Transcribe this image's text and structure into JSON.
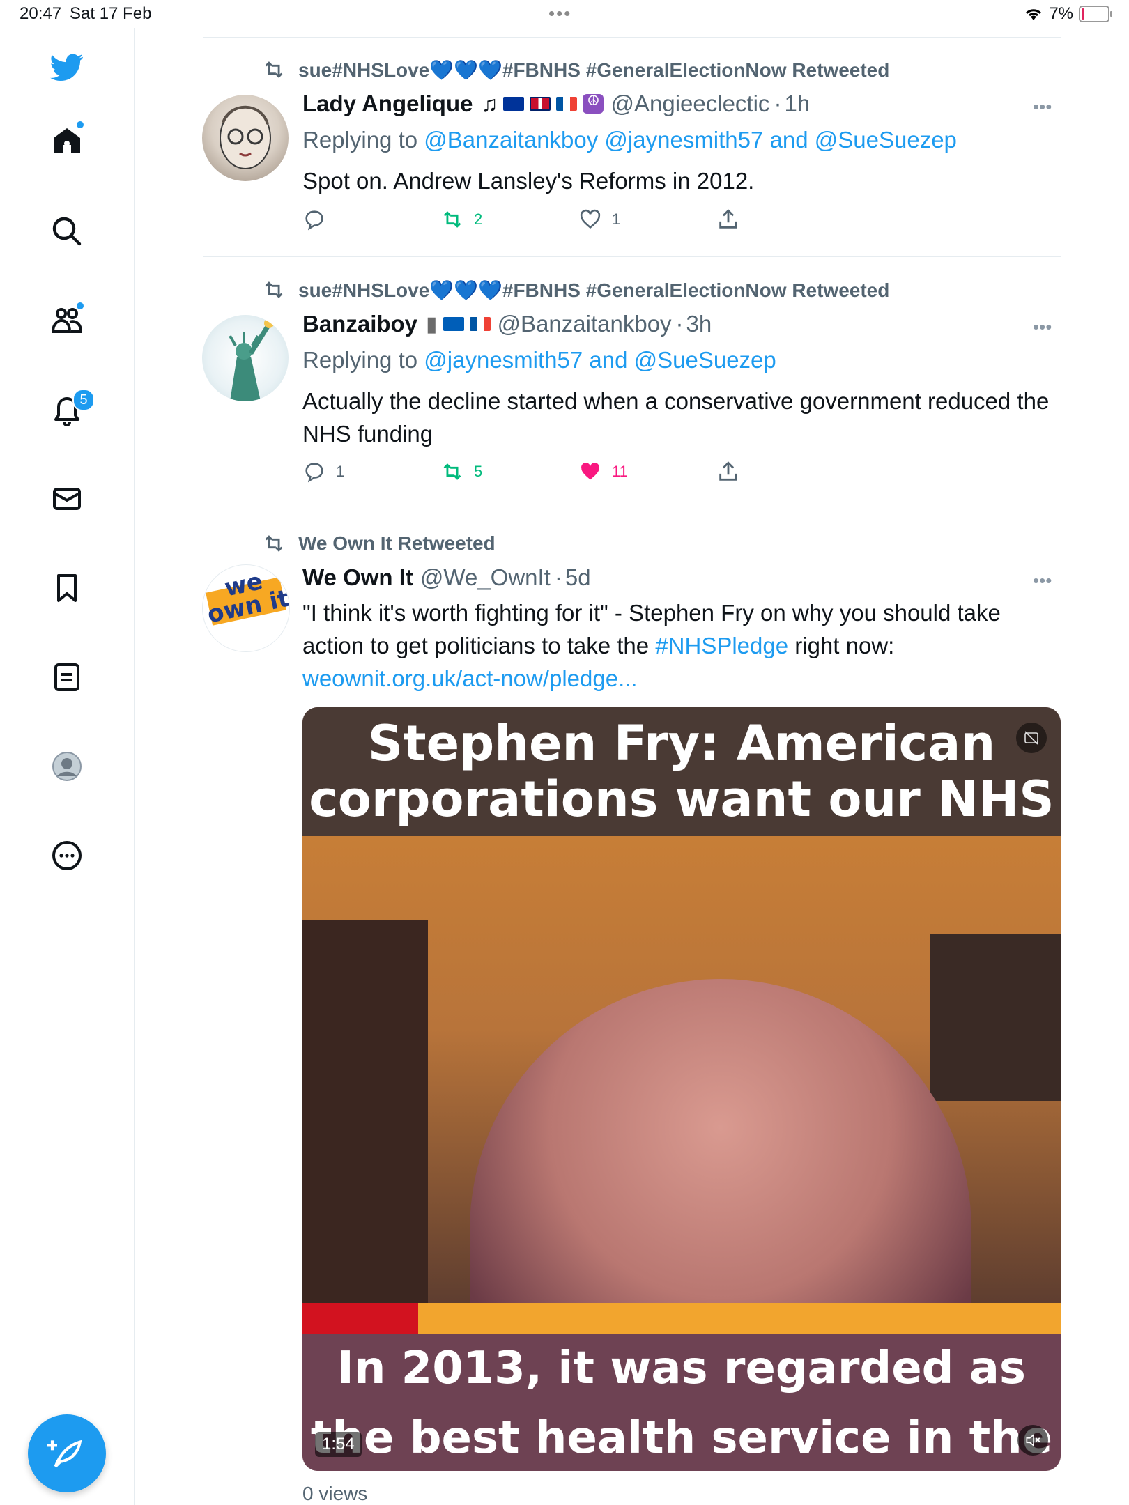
{
  "status_bar": {
    "time": "20:47",
    "date": "Sat 17 Feb",
    "battery": "7%"
  },
  "sidebar": {
    "notification_count": "5"
  },
  "tweets": [
    {
      "retweeted_by": "sue#NHSLove💙💙💙#FBNHS #GeneralElectionNow Retweeted",
      "name": "Lady Angelique",
      "handle": "@Angieeclectic",
      "time": "1h",
      "reply_prefix": "Replying to",
      "reply_to": "@Banzaitankboy @jaynesmith57 and @SueSuezep",
      "text": "Spot on. Andrew Lansley's Reforms in 2012.",
      "replies": "",
      "retweets": "2",
      "likes": "1"
    },
    {
      "retweeted_by": "sue#NHSLove💙💙💙#FBNHS #GeneralElectionNow Retweeted",
      "name": "Banzaiboy",
      "handle": "@Banzaitankboy",
      "time": "3h",
      "reply_prefix": "Replying to",
      "reply_to": "@jaynesmith57 and @SueSuezep",
      "text": "Actually the decline started when a conservative government reduced the NHS funding",
      "replies": "1",
      "retweets": "5",
      "likes": "11"
    },
    {
      "retweeted_by": "We Own It Retweeted",
      "name": "We Own It",
      "handle": "@We_OwnIt",
      "time": "5d",
      "text_part1": "\"I think it's worth fighting for it\" - Stephen Fry on why you should take action to get politicians to take the ",
      "hashtag": "#NHSPledge",
      "text_part2": " right now: ",
      "link": "weownit.org.uk/act-now/pledge...",
      "video_title": "Stephen Fry: American corporations want our NHS",
      "video_caption": "In 2013, it was regarded as the best health service in the",
      "video_duration": "1:54",
      "views": "0 views",
      "avatar_text": "we own it"
    }
  ],
  "colors": {
    "accent": "#1d9bf0",
    "retweet": "#00ba7c",
    "like": "#f91880"
  }
}
